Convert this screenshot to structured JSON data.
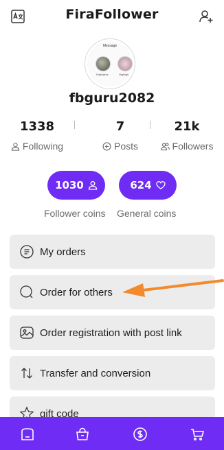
{
  "header": {
    "title": "FiraFollower",
    "left_icon": "translate-icon",
    "right_icon": "add-user-icon"
  },
  "profile": {
    "username": "fbguru2082",
    "avatar_preview": {
      "message_label": "Message",
      "highlight_1": "Highlights",
      "highlight_2": "Highligh"
    }
  },
  "stats": [
    {
      "value": "1338",
      "label": "Following",
      "icon": "person-icon"
    },
    {
      "value": "7",
      "label": "Posts",
      "icon": "plus-circle-icon"
    },
    {
      "value": "21k",
      "label": "Followers",
      "icon": "people-icon"
    }
  ],
  "coins": {
    "follower": {
      "value": "1030",
      "label": "Follower coins",
      "icon": "person-icon"
    },
    "general": {
      "value": "624",
      "label": "General coins",
      "icon": "heart-icon"
    }
  },
  "menu": [
    {
      "label": "My orders",
      "icon": "orders-icon"
    },
    {
      "label": "Order for others",
      "icon": "search-icon"
    },
    {
      "label": "Order registration with post link",
      "icon": "image-icon"
    },
    {
      "label": "Transfer and conversion",
      "icon": "transfer-icon"
    },
    {
      "label": "gift code",
      "icon": "star-icon"
    }
  ],
  "bottom_nav": [
    {
      "icon": "home-icon"
    },
    {
      "icon": "shop-bag-icon"
    },
    {
      "icon": "dollar-icon"
    },
    {
      "icon": "cart-icon"
    }
  ],
  "colors": {
    "accent": "#6f2cf4",
    "card_bg": "#ececec",
    "annotation_arrow": "#f28a2e"
  }
}
